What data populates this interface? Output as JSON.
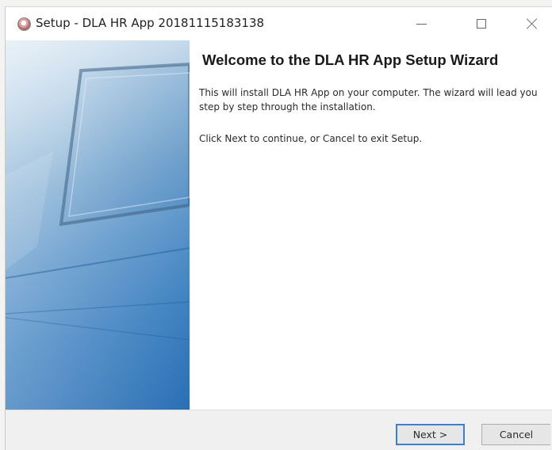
{
  "window": {
    "title": "Setup - DLA HR App 20181115183138",
    "app_icon": "setup-disc-icon"
  },
  "controls": {
    "minimize_icon": "minimize-icon",
    "maximize_icon": "maximize-icon",
    "close_icon": "close-icon"
  },
  "banner": {
    "image": "monitor-screen-banner",
    "colors": [
      "#cfe0ee",
      "#5f97c6",
      "#2a6fb5"
    ]
  },
  "content": {
    "heading": "Welcome to the DLA HR App Setup Wizard",
    "intro": "This will install DLA HR App on your computer. The wizard will lead you step by step through the installation.",
    "continue": "Click Next to continue, or Cancel to exit Setup."
  },
  "footer": {
    "next_label": "Next >",
    "cancel_label": "Cancel",
    "focus_color": "#3c7fd0"
  }
}
